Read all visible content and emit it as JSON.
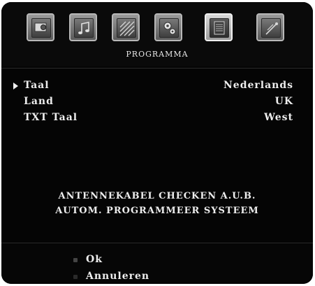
{
  "menu": {
    "title": "PROGRAMMA",
    "tabs": [
      {
        "icon": "picture-icon",
        "active": false
      },
      {
        "icon": "music-note-icon",
        "active": false
      },
      {
        "icon": "pattern-icon",
        "active": false
      },
      {
        "icon": "gears-icon",
        "active": false
      },
      {
        "icon": "list-document-icon",
        "active": true
      },
      {
        "icon": "satellite-dish-icon",
        "active": false
      }
    ]
  },
  "settings": [
    {
      "label": "Taal",
      "value": "Nederlands",
      "selected": true
    },
    {
      "label": "Land",
      "value": "UK",
      "selected": false
    },
    {
      "label": "TXT Taal",
      "value": "West",
      "selected": false
    }
  ],
  "message": {
    "line1": "ANTENNEKABEL CHECKEN A.U.B.",
    "line2": "AUTOM. PROGRAMMEER SYSTEEM"
  },
  "footer": {
    "ok_label": "Ok",
    "cancel_label": "Annuleren",
    "ok_color": "#444444",
    "cancel_color": "#2a2a2a"
  }
}
